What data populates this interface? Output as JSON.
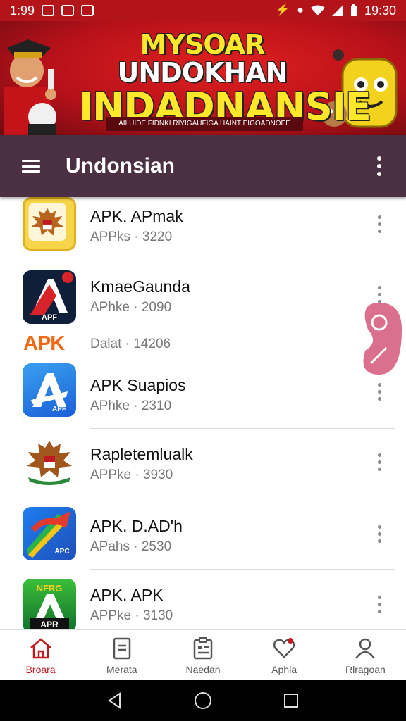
{
  "status_bar": {
    "time_left": "1:99",
    "time_right": "19:30",
    "bg": "#b3141a"
  },
  "banner": {
    "line1_a": "MYSOAR",
    "line1_b": "UNDOKHAN",
    "line2": "INDADNANSIE",
    "subtitle": "AILUIDE FIDNKI RIYIGAUFIGA HAINT EIGOADNOEE"
  },
  "app_bar": {
    "title": "Undonsian",
    "bg": "#4b2f42"
  },
  "apps": [
    {
      "name": "APK. APmak",
      "sub": "APPks · 3220",
      "icon": "garuda-icon"
    },
    {
      "name": "KmaeGaunda",
      "sub": "APhke · 2090",
      "icon": "apk-red-icon"
    },
    {
      "name": "APK Suapios",
      "sub": "APhke · 2310",
      "icon": "apk-blue-icon"
    },
    {
      "name": "Rapletemlualk",
      "sub": "APPke · 3930",
      "icon": "garuda-green-icon"
    },
    {
      "name": "APK. D.AD'h",
      "sub": "APahs · 2530",
      "icon": "apk-rainbow-icon"
    },
    {
      "name": "APK. APK",
      "sub": "APPke · 3130",
      "icon": "apk-green-icon"
    }
  ],
  "ad_row": {
    "tag": "APK",
    "sub": "Dalat · 14206"
  },
  "icon_labels": {
    "apf": "APF",
    "apr": "APR",
    "apc": "APC",
    "apf2": "APF",
    "nfrs": "NFRG"
  },
  "bottom_nav": [
    {
      "label": "Broara",
      "icon": "home-icon",
      "active": true
    },
    {
      "label": "Merata",
      "icon": "document-icon",
      "active": false
    },
    {
      "label": "Naedan",
      "icon": "clipboard-icon",
      "active": false
    },
    {
      "label": "Aphla",
      "icon": "heart-icon",
      "active": false
    },
    {
      "label": "Rlragoan",
      "icon": "person-icon",
      "active": false
    }
  ],
  "colors": {
    "accent": "#c0191f",
    "apk_orange": "#f06a16"
  }
}
